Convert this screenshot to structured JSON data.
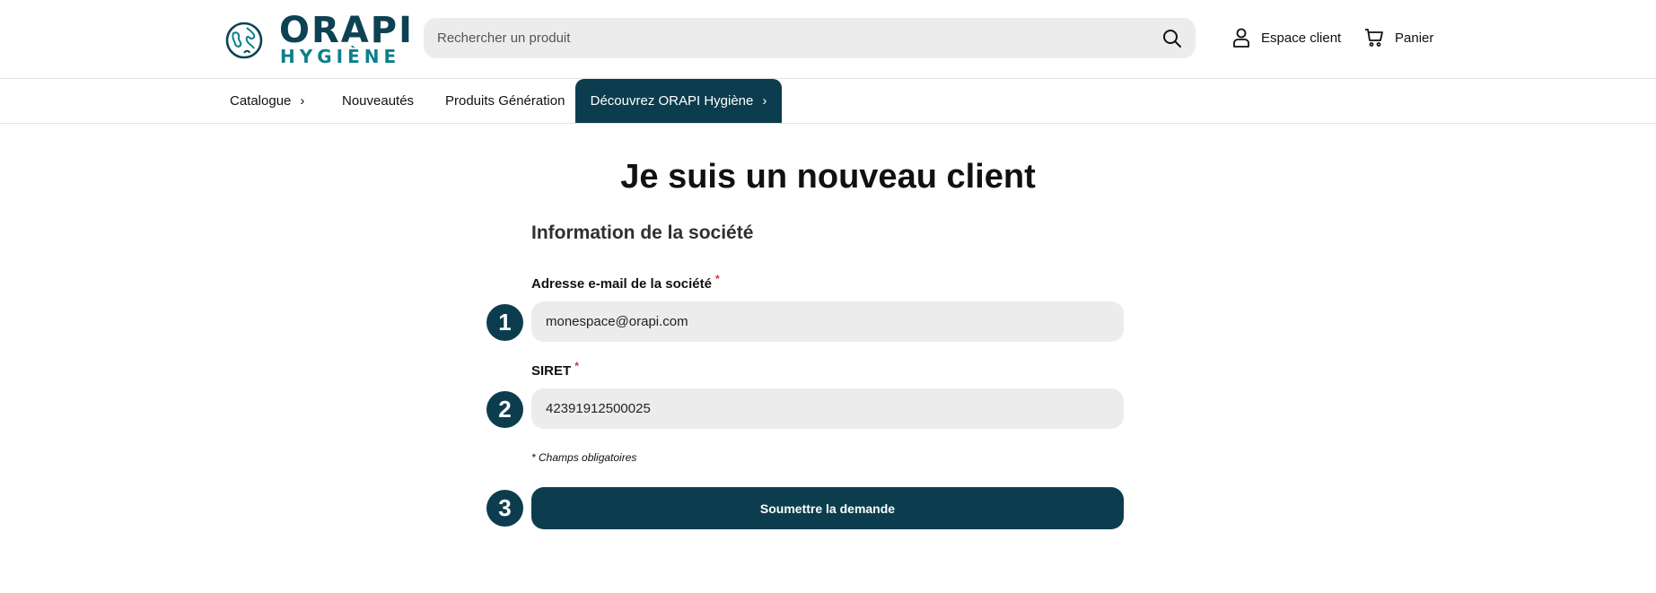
{
  "brand": {
    "name": "ORAPI",
    "sub": "HYGIÈNE",
    "primary_color": "#0c3d4f",
    "accent_color": "#0e7f8c"
  },
  "header": {
    "search_placeholder": "Rechercher un produit",
    "search_icon": "search-icon",
    "account_label": "Espace client",
    "account_icon": "user-icon",
    "cart_label": "Panier",
    "cart_icon": "cart-icon"
  },
  "nav": {
    "items": [
      {
        "label": "Catalogue",
        "chevron": "›"
      },
      {
        "label": "Nouveautés"
      },
      {
        "label": "Produits Génération"
      },
      {
        "label": "Découvrez ORAPI Hygiène",
        "chevron": "›",
        "active": true
      }
    ]
  },
  "main": {
    "title": "Je suis un nouveau client",
    "section_title": "Information de la société",
    "fields": [
      {
        "label": "Adresse e-mail de la société",
        "required_mark": "*",
        "value": "monespace@orapi.com"
      },
      {
        "label": "SIRET",
        "required_mark": "*",
        "value": "42391912500025"
      }
    ],
    "required_note": "* Champs obligatoires",
    "submit_label": "Soumettre la demande",
    "steps": [
      "1",
      "2",
      "3"
    ]
  }
}
